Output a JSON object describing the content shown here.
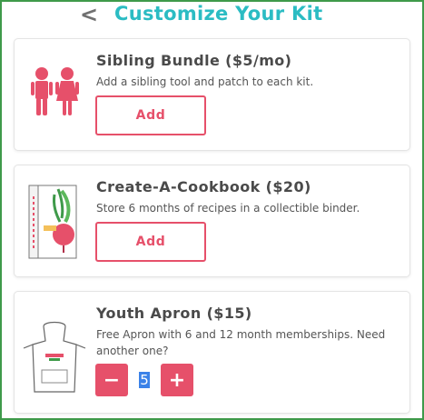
{
  "header": {
    "back_icon": "chevron-left-icon",
    "back_glyph": "<",
    "title": "Customize Your Kit"
  },
  "items": [
    {
      "title": "Sibling Bundle ($5/mo)",
      "description": "Add a sibling tool and patch to each kit.",
      "button_label": "Add",
      "thumbnail": "siblings-icon"
    },
    {
      "title": "Create-A-Cookbook ($20)",
      "description": "Store 6 months of recipes in a collectible binder.",
      "button_label": "Add",
      "thumbnail": "cookbook-binder-image"
    },
    {
      "title": "Youth Apron ($15)",
      "description": "Free Apron with 6 and 12 month memberships. Need another one?",
      "quantity": "5",
      "minus_glyph": "−",
      "plus_glyph": "+",
      "thumbnail": "apron-image"
    }
  ],
  "colors": {
    "accent": "#e6506a",
    "title": "#2bbcc3",
    "frame": "#3f9a4a"
  }
}
